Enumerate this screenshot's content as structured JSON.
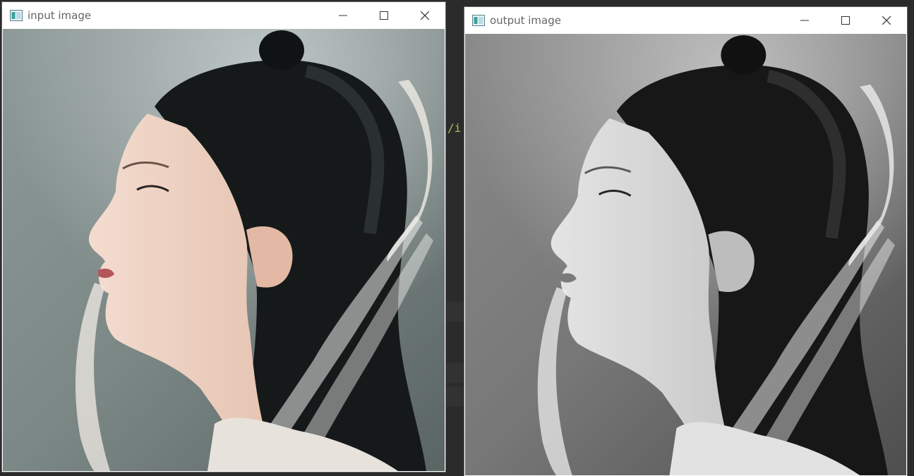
{
  "windows": {
    "input": {
      "title": "input image",
      "icon": "opencv-window-icon",
      "controls": [
        "minimize-icon",
        "maximize-icon",
        "close-icon"
      ],
      "image_desc": "color photo of a woman in profile with dark braided hair and sheer ribbons"
    },
    "output": {
      "title": "output image",
      "icon": "opencv-window-icon",
      "controls": [
        "minimize-icon",
        "maximize-icon",
        "close-icon"
      ],
      "image_desc": "grayscale version of the same photo"
    }
  },
  "background": {
    "code_fragment": "/i",
    "editor_color": "#2b2b2b"
  },
  "colors": {
    "titlebar": "#ffffff",
    "title_text": "#666666",
    "icon_teal": "#3aa39a"
  }
}
